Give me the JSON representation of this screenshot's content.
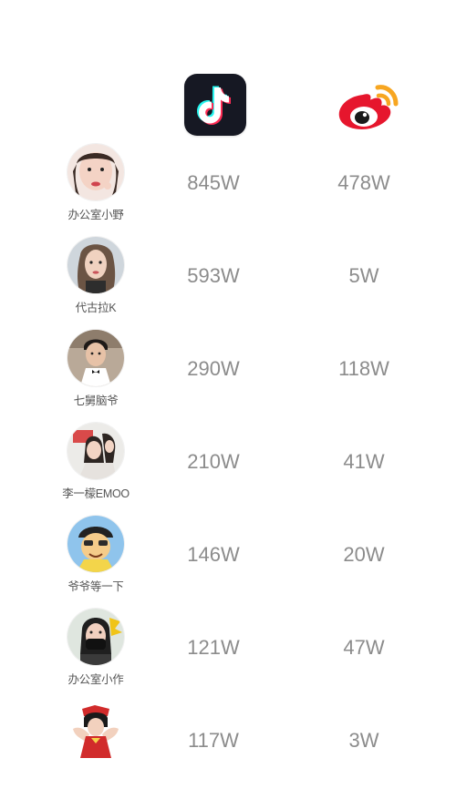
{
  "platforms": {
    "tiktok": {
      "icon": "tiktok-logo-icon",
      "bg": "#161823",
      "cyan": "#25F4EE",
      "pink": "#FE2C55"
    },
    "weibo": {
      "icon": "weibo-logo-icon",
      "red": "#E6162D",
      "orange": "#F7A621"
    }
  },
  "rows": [
    {
      "name": "办公室小野",
      "tiktok": "845W",
      "weibo": "478W",
      "avatar_color": "#e8b8a8"
    },
    {
      "name": "代古拉K",
      "tiktok": "593W",
      "weibo": "5W",
      "avatar_color": "#c7b7a8"
    },
    {
      "name": "七舅脑爷",
      "tiktok": "290W",
      "weibo": "118W",
      "avatar_color": "#9a8a7a"
    },
    {
      "name": "李一檬EMOO",
      "tiktok": "210W",
      "weibo": "41W",
      "avatar_color": "#d9c0b0"
    },
    {
      "name": "爷爷等一下",
      "tiktok": "146W",
      "weibo": "20W",
      "avatar_color": "#7fb3e0"
    },
    {
      "name": "办公室小作",
      "tiktok": "121W",
      "weibo": "47W",
      "avatar_color": "#6a7a8a"
    },
    {
      "name": "",
      "tiktok": "117W",
      "weibo": "3W",
      "avatar_color": "#d73a3a"
    }
  ]
}
